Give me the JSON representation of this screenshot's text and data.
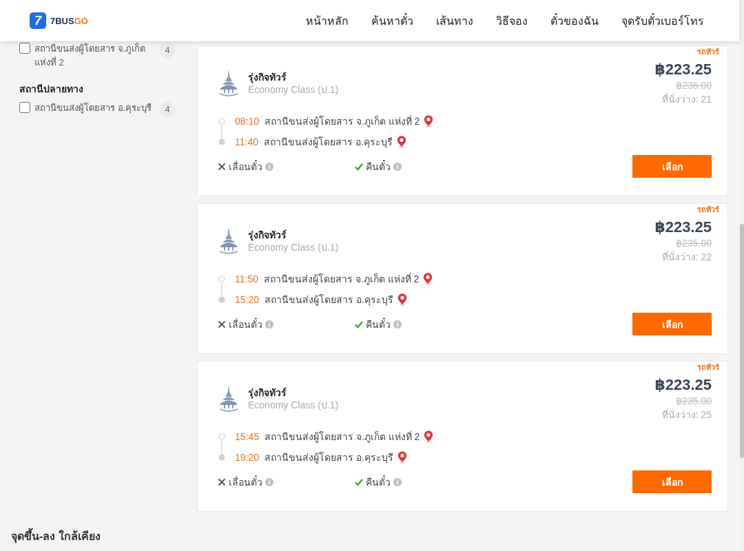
{
  "header": {
    "logo": {
      "mark": "7",
      "brand": "7BUS",
      "brand_accent": "GO"
    },
    "nav": [
      {
        "label": "หน้าหลัก"
      },
      {
        "label": "ค้นหาตั๋ว"
      },
      {
        "label": "เส้นทาง"
      },
      {
        "label": "วิธีจอง"
      },
      {
        "label": "ตั๋วของฉัน"
      },
      {
        "label": "จุดรับตั๋วเบอร์โทร"
      }
    ]
  },
  "sidebar": {
    "groups": [
      {
        "options": [
          {
            "label": "สถานีขนส่งผู้โดยสาร จ.ภูเก็ต แห่งที่ 2",
            "count": "4",
            "checked": false
          }
        ]
      },
      {
        "title": "สถานีปลายทาง",
        "options": [
          {
            "label": "สถานีขนส่งผู้โดยสาร อ.คุระบุรี",
            "count": "4",
            "checked": false
          }
        ]
      }
    ]
  },
  "trips": [
    {
      "tag": "รถทัวร์",
      "operator": "รุ่งกิจทัวร์",
      "class": "Economy Class (ป.1)",
      "price": "฿223.25",
      "old_price": "฿235.00",
      "seats": "ที่นั่งว่าง: 21",
      "stops": [
        {
          "time": "08:10",
          "station": "สถานีขนส่งผู้โดยสาร จ.ภูเก็ต แห่งที่ 2"
        },
        {
          "time": "11:40",
          "station": "สถานีขนส่งผู้โดยสาร อ.คุระบุรี"
        }
      ],
      "policies": [
        {
          "label": "เลื่อนตั๋ว",
          "allowed": false
        },
        {
          "label": "คืนตั๋ว",
          "allowed": true
        }
      ],
      "button": "เลือก"
    },
    {
      "tag": "รถทัวร์",
      "operator": "รุ่งกิจทัวร์",
      "class": "Economy Class (ป.1)",
      "price": "฿223.25",
      "old_price": "฿235.00",
      "seats": "ที่นั่งว่าง: 22",
      "stops": [
        {
          "time": "11:50",
          "station": "สถานีขนส่งผู้โดยสาร จ.ภูเก็ต แห่งที่ 2"
        },
        {
          "time": "15:20",
          "station": "สถานีขนส่งผู้โดยสาร อ.คุระบุรี"
        }
      ],
      "policies": [
        {
          "label": "เลื่อนตั๋ว",
          "allowed": false
        },
        {
          "label": "คืนตั๋ว",
          "allowed": true
        }
      ],
      "button": "เลือก"
    },
    {
      "tag": "รถทัวร์",
      "operator": "รุ่งกิจทัวร์",
      "class": "Economy Class (ป.1)",
      "price": "฿223.25",
      "old_price": "฿235.00",
      "seats": "ที่นั่งว่าง: 25",
      "stops": [
        {
          "time": "15:45",
          "station": "สถานีขนส่งผู้โดยสาร จ.ภูเก็ต แห่งที่ 2"
        },
        {
          "time": "19:20",
          "station": "สถานีขนส่งผู้โดยสาร อ.คุระบุรี"
        }
      ],
      "policies": [
        {
          "label": "เลื่อนตั๋ว",
          "allowed": false
        },
        {
          "label": "คืนตั๋ว",
          "allowed": true
        }
      ],
      "button": "เลือก"
    }
  ],
  "nearby": {
    "title": "จุดขึ้น-ลง ใกล้เคียง"
  }
}
